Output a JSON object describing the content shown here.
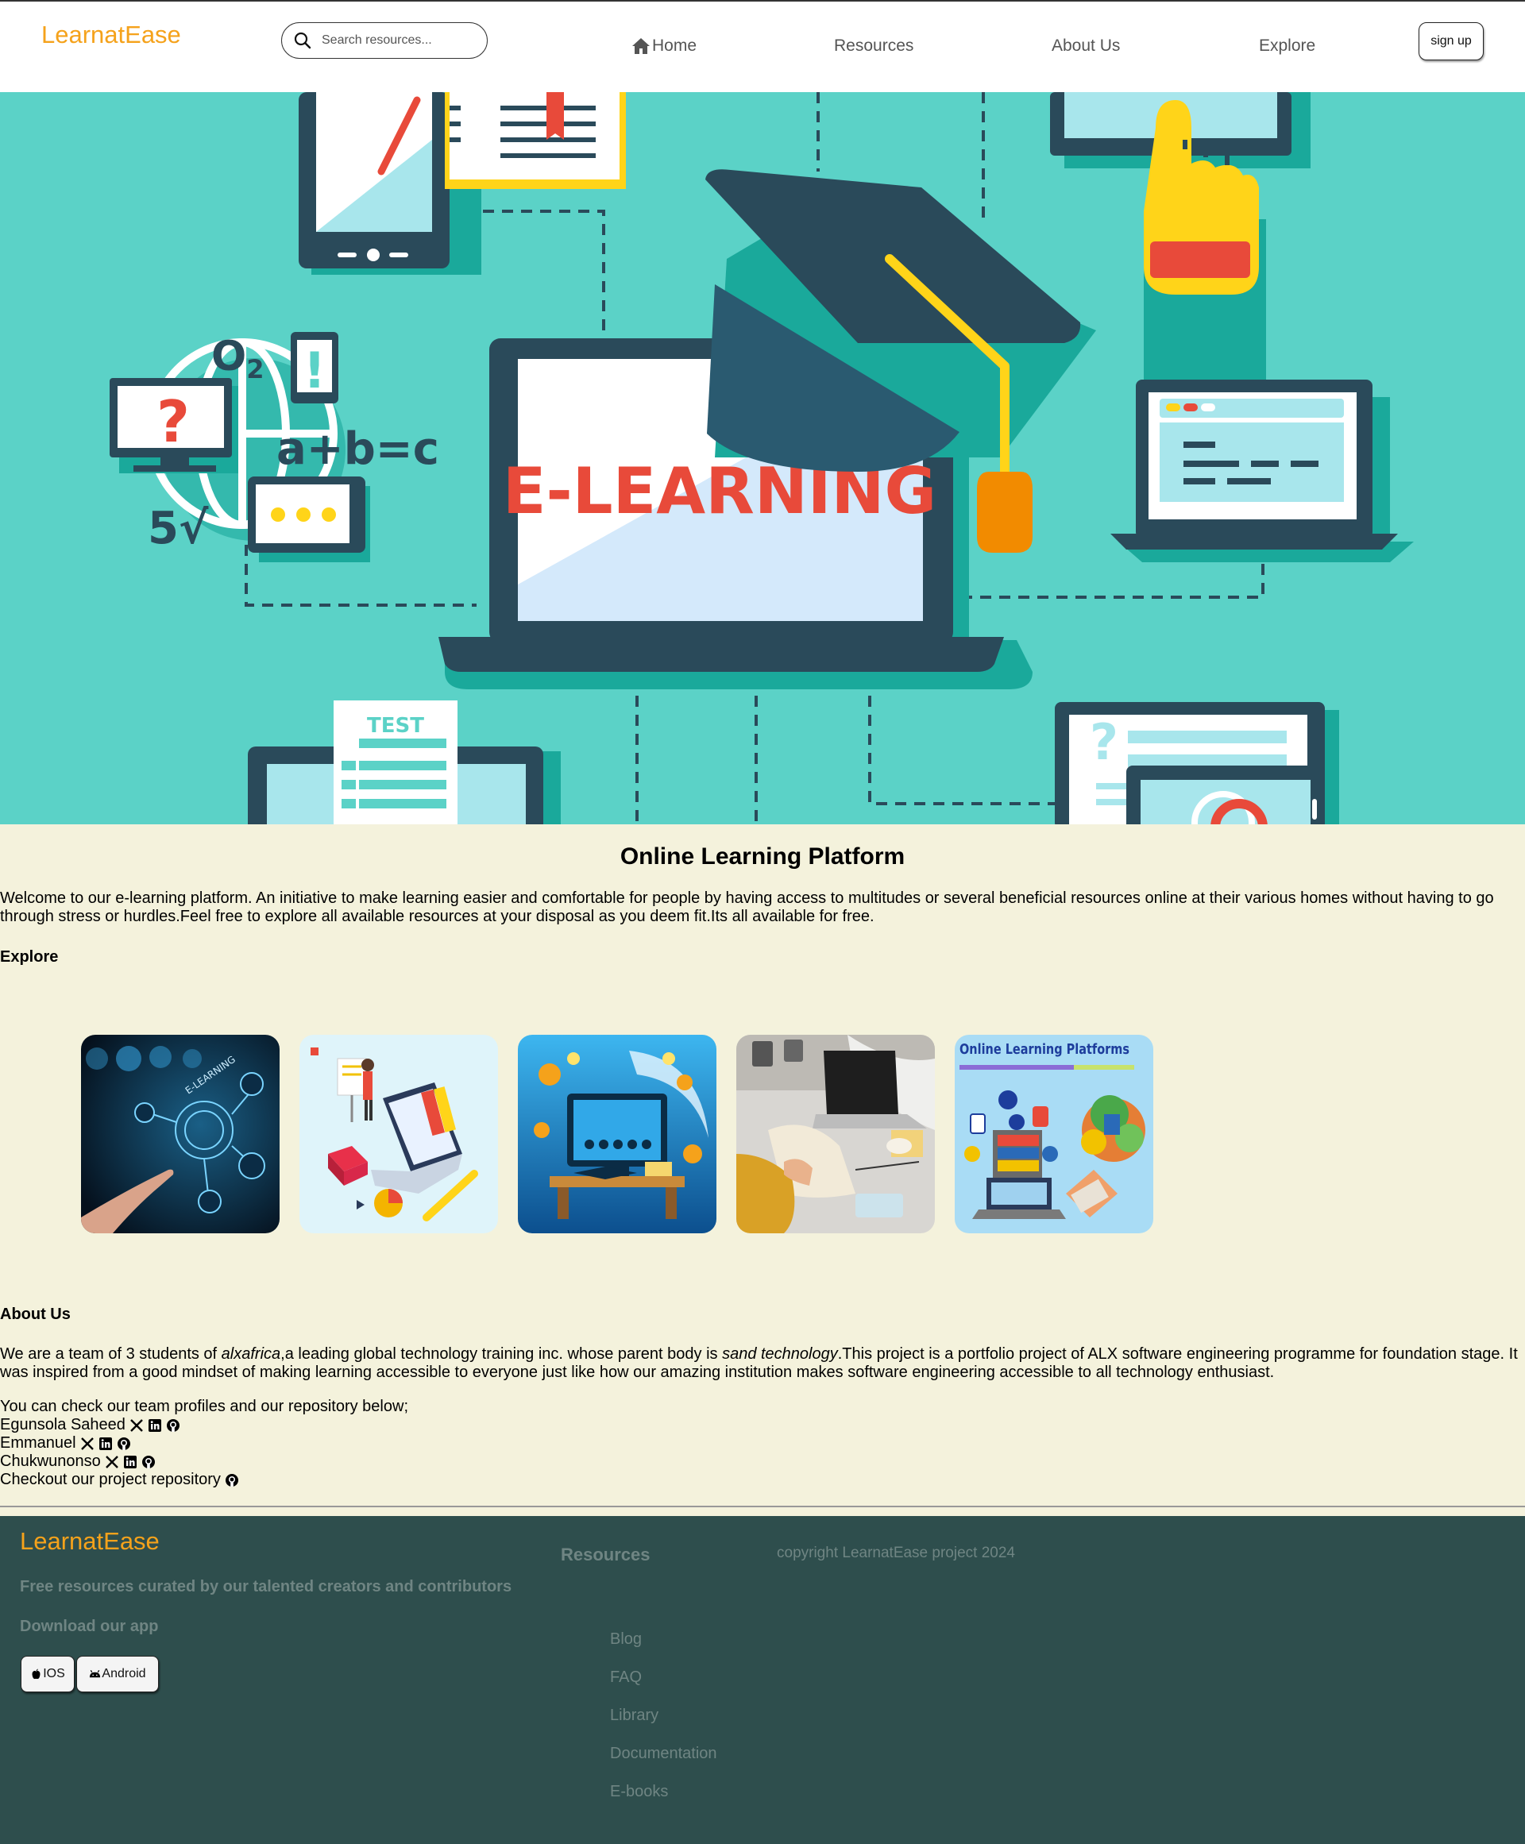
{
  "header": {
    "logo": "LearnatEase",
    "search_placeholder": "Search resources...",
    "nav": {
      "home": "Home",
      "resources": "Resources",
      "about": "About Us",
      "explore": "Explore"
    },
    "signup": "sign up"
  },
  "hero": {
    "screen_text": "E-LEARNING",
    "test_label": "TEST",
    "o2": "O",
    "o2_sub": "2",
    "equation": "a+b=c",
    "root": "5√",
    "question": "?",
    "exclaim": "!",
    "cards_title": "Online Learning Platforms",
    "card1_text": "E-LEARNING"
  },
  "main": {
    "title": "Online Learning Platform",
    "intro": "Welcome to our e-learning platform. An initiative to make learning easier and comfortable for people by having access to multitudes or several beneficial resources online at their various homes without having to go through stress or hurdles.Feel free to explore all available resources at your disposal as you deem fit.Its all available for free.",
    "explore_heading": "Explore",
    "about_heading": "About Us",
    "about": {
      "p1": "We are a team of 3 students of ",
      "em1": "alxafrica",
      "p2": ",a leading global technology training inc. whose parent body is ",
      "em2": "sand technology",
      "p3": ".This project is a portfolio project of ALX software engineering programme for foundation stage. It was inspired from a good mindset of making learning accessible to everyone just like how our amazing institution makes software engineering accessible to all technology enthusiast."
    },
    "team_intro": "You can check our team profiles and our repository below;",
    "members": [
      "Egunsola Saheed",
      "Emmanuel",
      "Chukwunonso"
    ],
    "repo_text": "Checkout our project repository"
  },
  "footer": {
    "logo": "LearnatEase",
    "tagline": "Free resources curated by our talented creators and contributors",
    "download": "Download our app",
    "ios": "IOS",
    "android": "Android",
    "resources_heading": "Resources",
    "links": [
      "Blog",
      "FAQ",
      "Library",
      "Documentation",
      "E-books"
    ],
    "copyright": "copyright LearnatEase project 2024"
  },
  "colors": {
    "brand": "#f5a21b",
    "hero_bg": "#5bd2c7",
    "page_bg": "#f4f2dc",
    "footer_bg": "#2e4e4d",
    "footer_text": "#6f8583"
  },
  "icons": [
    "search-icon",
    "home-icon",
    "x-icon",
    "linkedin-icon",
    "github-icon",
    "apple-icon",
    "android-icon"
  ]
}
